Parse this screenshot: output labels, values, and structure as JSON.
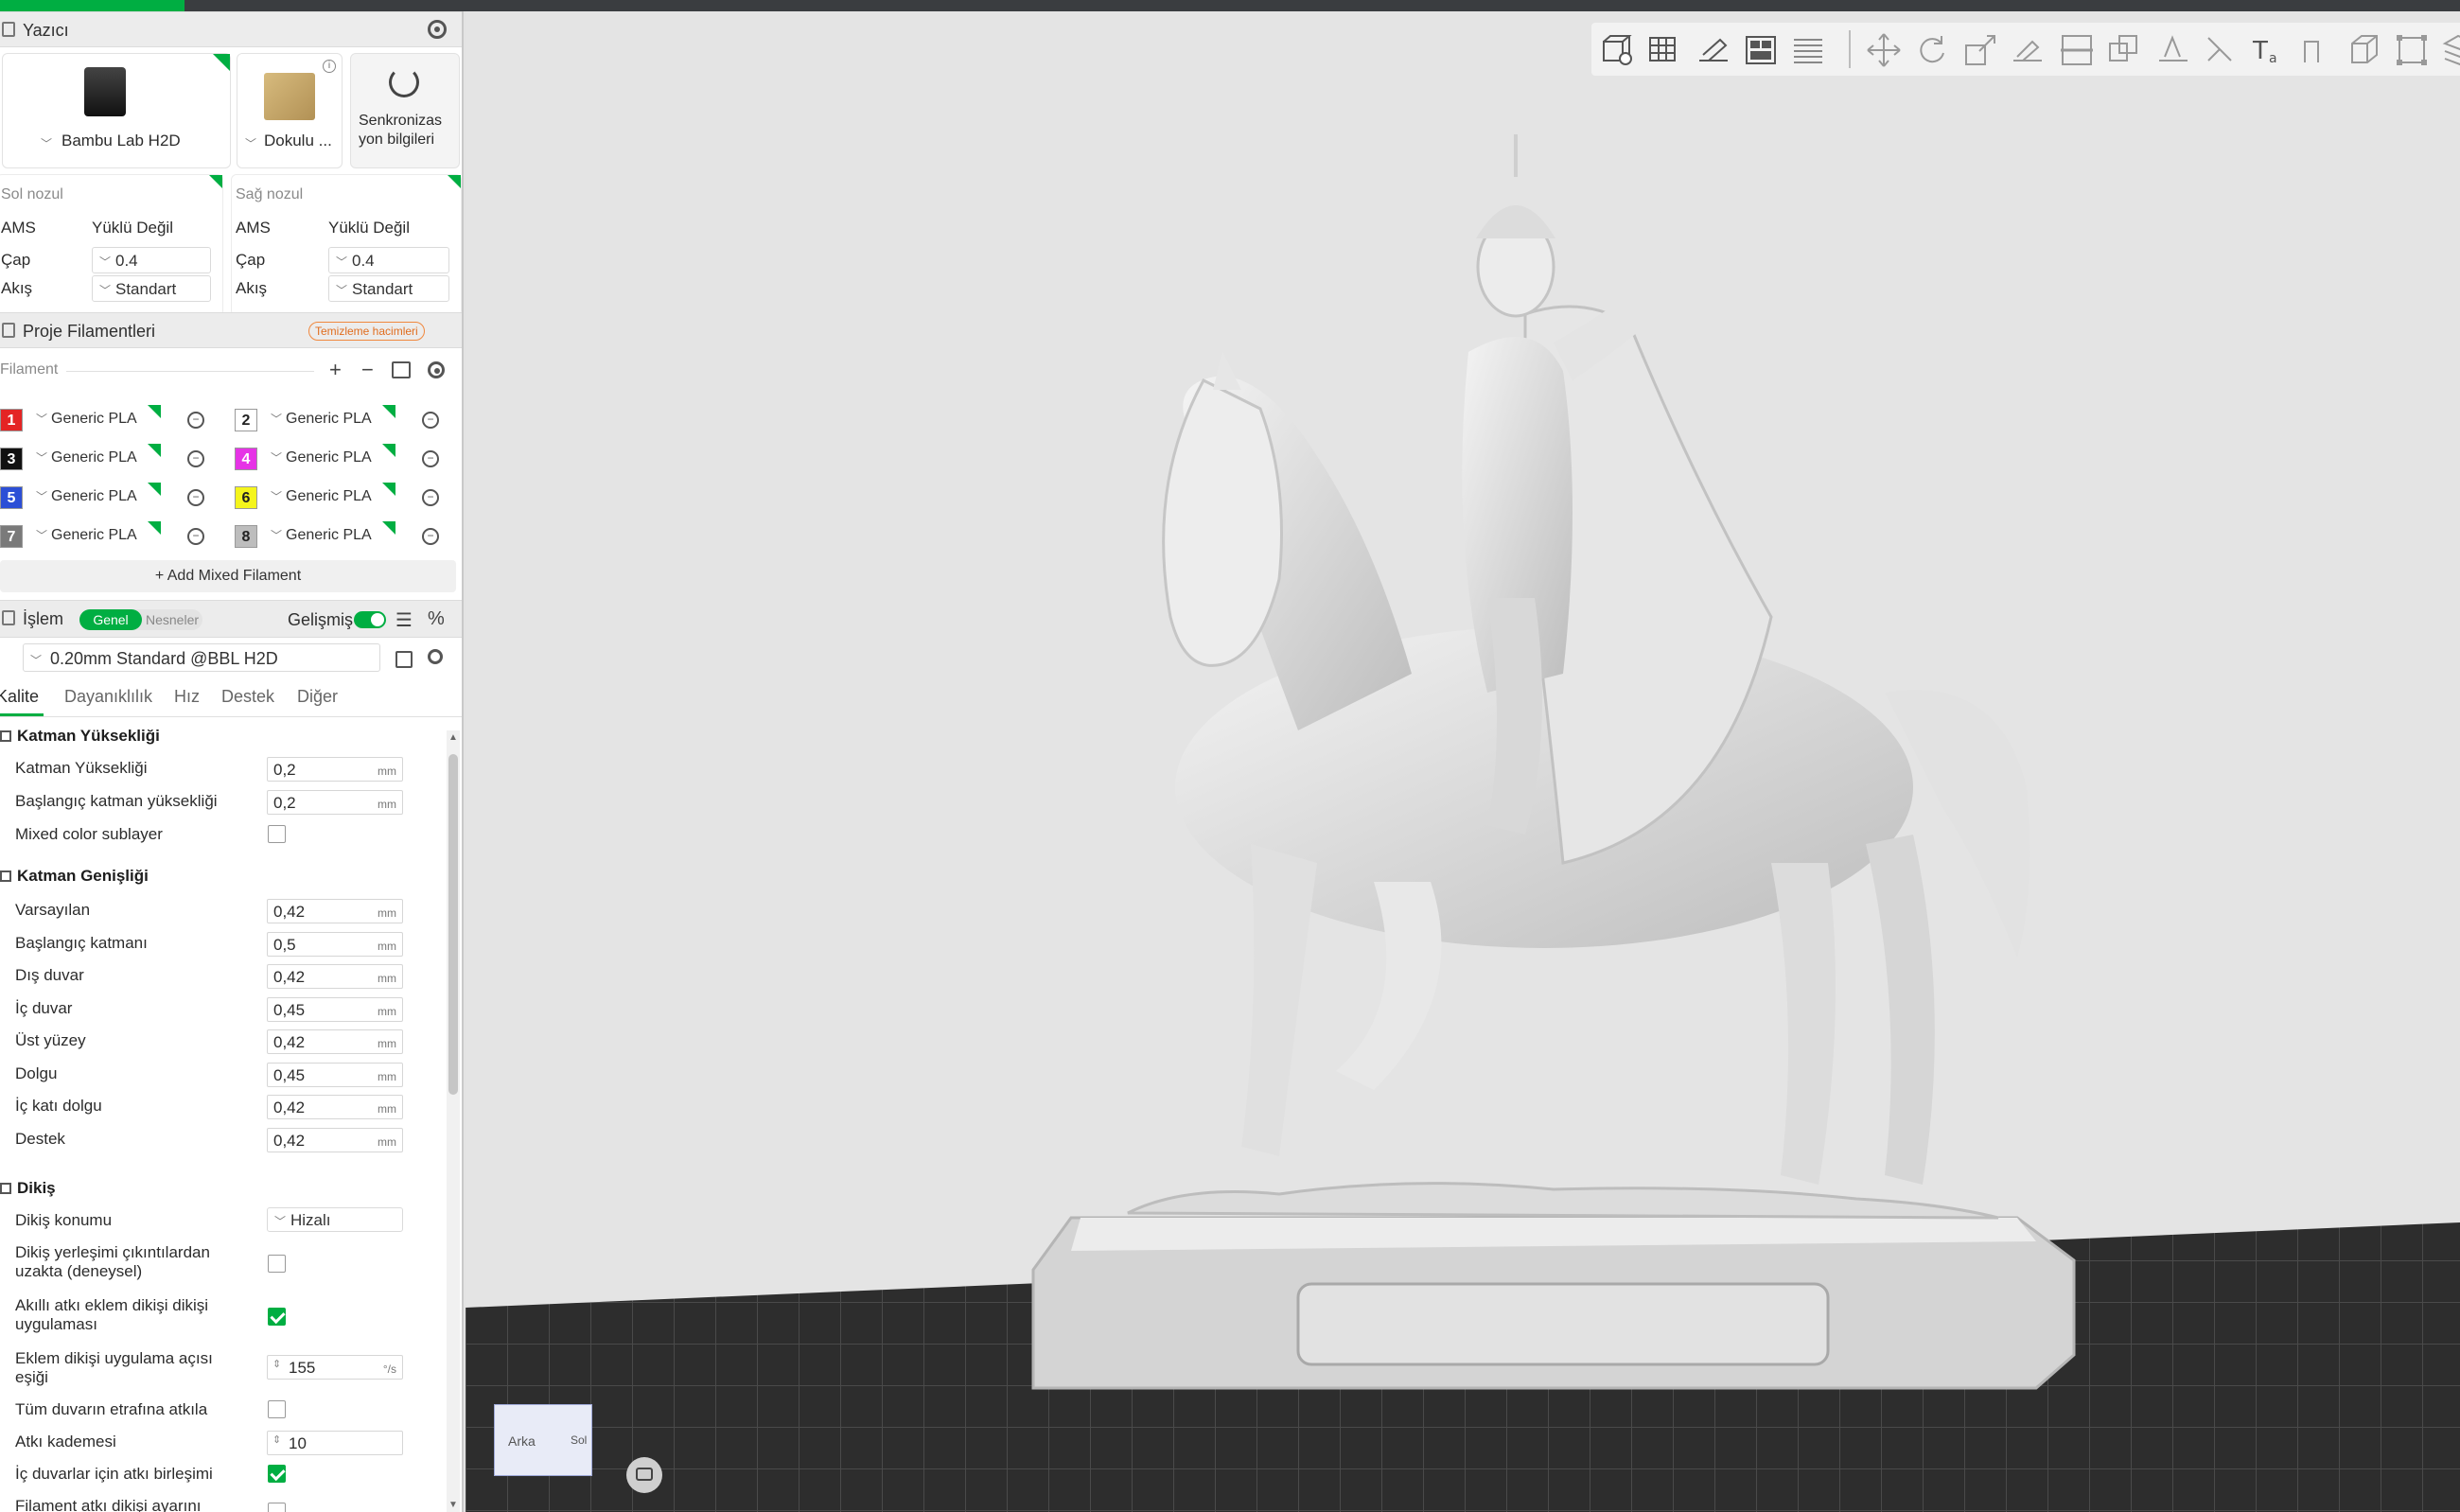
{
  "printer": {
    "section_title": "Yazıcı",
    "printer_name": "Bambu Lab H2D",
    "plate_name": "Dokulu ...",
    "sync_label_line1": "Senkronizas",
    "sync_label_line2": "yon bilgileri"
  },
  "nozzles": {
    "left": {
      "title": "Sol nozul",
      "ams_label": "AMS",
      "ams_value": "Yüklü Değil",
      "diameter_label": "Çap",
      "diameter_value": "0.4",
      "flow_label": "Akış",
      "flow_value": "Standart"
    },
    "right": {
      "title": "Sağ nozul",
      "ams_label": "AMS",
      "ams_value": "Yüklü Değil",
      "diameter_label": "Çap",
      "diameter_value": "0.4",
      "flow_label": "Akış",
      "flow_value": "Standart"
    }
  },
  "filaments": {
    "section_title": "Proje Filamentleri",
    "purge_badge": "Temizleme hacimleri",
    "placeholder": "Filament",
    "items": [
      {
        "num": "1",
        "name": "Generic PLA",
        "color": "#e42424",
        "text_color": "#ffffff"
      },
      {
        "num": "2",
        "name": "Generic PLA",
        "color": "#ffffff",
        "text_color": "#222222"
      },
      {
        "num": "3",
        "name": "Generic PLA",
        "color": "#111111",
        "text_color": "#ffffff"
      },
      {
        "num": "4",
        "name": "Generic PLA",
        "color": "#e633e6",
        "text_color": "#ffffff"
      },
      {
        "num": "5",
        "name": "Generic PLA",
        "color": "#2c4fd6",
        "text_color": "#ffffff"
      },
      {
        "num": "6",
        "name": "Generic PLA",
        "color": "#f5f51c",
        "text_color": "#222222"
      },
      {
        "num": "7",
        "name": "Generic PLA",
        "color": "#7a7a7a",
        "text_color": "#ffffff"
      },
      {
        "num": "8",
        "name": "Generic PLA",
        "color": "#bdbdbd",
        "text_color": "#222222"
      }
    ],
    "add_mixed": "+ Add Mixed Filament"
  },
  "process": {
    "section_title": "İşlem",
    "pill_general": "Genel",
    "pill_objects": "Nesneler",
    "advanced_label": "Gelişmiş",
    "profile": "0.20mm Standard @BBL H2D",
    "tabs": [
      "Kalite",
      "Dayanıklılık",
      "Hız",
      "Destek",
      "Diğer"
    ]
  },
  "settings": {
    "group1": "Katman Yüksekliği",
    "layer_height": {
      "label": "Katman Yüksekliği",
      "value": "0,2",
      "unit": "mm"
    },
    "initial_layer_height": {
      "label": "Başlangıç katman yüksekliği",
      "value": "0,2",
      "unit": "mm"
    },
    "mixed_color": {
      "label": "Mixed color sublayer"
    },
    "group2": "Katman Genişliği",
    "widths": [
      {
        "label": "Varsayılan",
        "value": "0,42",
        "unit": "mm"
      },
      {
        "label": "Başlangıç katmanı",
        "value": "0,5",
        "unit": "mm"
      },
      {
        "label": "Dış duvar",
        "value": "0,42",
        "unit": "mm"
      },
      {
        "label": "İç duvar",
        "value": "0,45",
        "unit": "mm"
      },
      {
        "label": "Üst yüzey",
        "value": "0,42",
        "unit": "mm"
      },
      {
        "label": "Dolgu",
        "value": "0,45",
        "unit": "mm"
      },
      {
        "label": "İç katı dolgu",
        "value": "0,42",
        "unit": "mm"
      },
      {
        "label": "Destek",
        "value": "0,42",
        "unit": "mm"
      }
    ],
    "group3": "Dikiş",
    "seam_position": {
      "label": "Dikiş konumu",
      "value": "Hizalı"
    },
    "seam_avoid_line1": "Dikiş yerleşimi çıkıntılardan",
    "seam_avoid_line2": "uzakta (deneysel)",
    "smart_seam_line1": "Akıllı atkı eklem dikişi dikişi",
    "smart_seam_line2": "uygulaması",
    "seam_angle_line1": "Eklem dikişi uygulama açısı",
    "seam_angle_line2": "eşiği",
    "seam_angle_value": "155",
    "seam_angle_unit": "°/s",
    "all_walls": "Tüm duvarın etrafına atkıla",
    "scarf_steps": {
      "label": "Atkı kademesi",
      "value": "10"
    },
    "inner_walls": "İç duvarlar için atkı birleşimi",
    "filament_seam": "Filament atkı dikişi ayarını"
  },
  "viewport": {
    "nav_back": "Arka",
    "nav_left": "Sol"
  },
  "icons": [
    "gear-icon",
    "sync-icon",
    "plus-icon",
    "minus-icon",
    "settings-icon",
    "save-icon",
    "search-icon",
    "list-icon",
    "percent-icon"
  ]
}
